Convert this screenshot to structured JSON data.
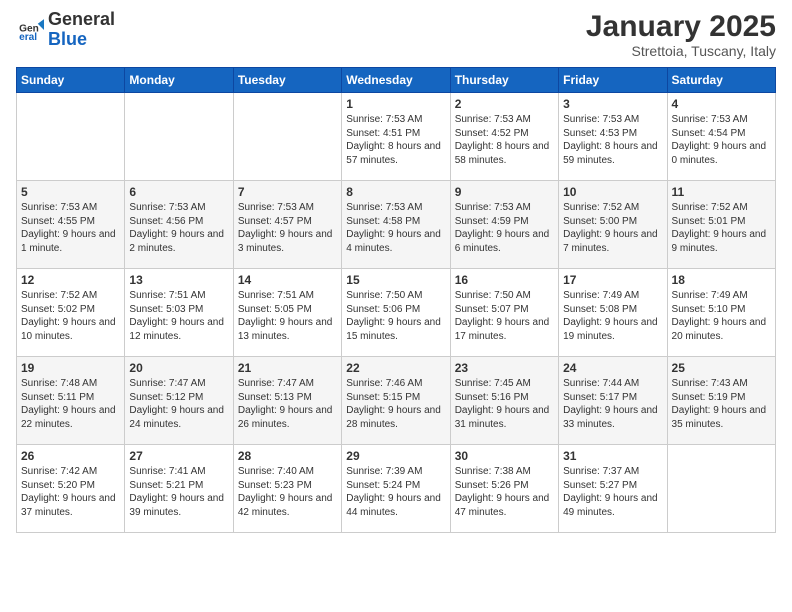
{
  "logo": {
    "general": "General",
    "blue": "Blue"
  },
  "header": {
    "month": "January 2025",
    "location": "Strettoia, Tuscany, Italy"
  },
  "weekdays": [
    "Sunday",
    "Monday",
    "Tuesday",
    "Wednesday",
    "Thursday",
    "Friday",
    "Saturday"
  ],
  "weeks": [
    [
      {
        "day": "",
        "info": ""
      },
      {
        "day": "",
        "info": ""
      },
      {
        "day": "",
        "info": ""
      },
      {
        "day": "1",
        "info": "Sunrise: 7:53 AM\nSunset: 4:51 PM\nDaylight: 8 hours and 57 minutes."
      },
      {
        "day": "2",
        "info": "Sunrise: 7:53 AM\nSunset: 4:52 PM\nDaylight: 8 hours and 58 minutes."
      },
      {
        "day": "3",
        "info": "Sunrise: 7:53 AM\nSunset: 4:53 PM\nDaylight: 8 hours and 59 minutes."
      },
      {
        "day": "4",
        "info": "Sunrise: 7:53 AM\nSunset: 4:54 PM\nDaylight: 9 hours and 0 minutes."
      }
    ],
    [
      {
        "day": "5",
        "info": "Sunrise: 7:53 AM\nSunset: 4:55 PM\nDaylight: 9 hours and 1 minute."
      },
      {
        "day": "6",
        "info": "Sunrise: 7:53 AM\nSunset: 4:56 PM\nDaylight: 9 hours and 2 minutes."
      },
      {
        "day": "7",
        "info": "Sunrise: 7:53 AM\nSunset: 4:57 PM\nDaylight: 9 hours and 3 minutes."
      },
      {
        "day": "8",
        "info": "Sunrise: 7:53 AM\nSunset: 4:58 PM\nDaylight: 9 hours and 4 minutes."
      },
      {
        "day": "9",
        "info": "Sunrise: 7:53 AM\nSunset: 4:59 PM\nDaylight: 9 hours and 6 minutes."
      },
      {
        "day": "10",
        "info": "Sunrise: 7:52 AM\nSunset: 5:00 PM\nDaylight: 9 hours and 7 minutes."
      },
      {
        "day": "11",
        "info": "Sunrise: 7:52 AM\nSunset: 5:01 PM\nDaylight: 9 hours and 9 minutes."
      }
    ],
    [
      {
        "day": "12",
        "info": "Sunrise: 7:52 AM\nSunset: 5:02 PM\nDaylight: 9 hours and 10 minutes."
      },
      {
        "day": "13",
        "info": "Sunrise: 7:51 AM\nSunset: 5:03 PM\nDaylight: 9 hours and 12 minutes."
      },
      {
        "day": "14",
        "info": "Sunrise: 7:51 AM\nSunset: 5:05 PM\nDaylight: 9 hours and 13 minutes."
      },
      {
        "day": "15",
        "info": "Sunrise: 7:50 AM\nSunset: 5:06 PM\nDaylight: 9 hours and 15 minutes."
      },
      {
        "day": "16",
        "info": "Sunrise: 7:50 AM\nSunset: 5:07 PM\nDaylight: 9 hours and 17 minutes."
      },
      {
        "day": "17",
        "info": "Sunrise: 7:49 AM\nSunset: 5:08 PM\nDaylight: 9 hours and 19 minutes."
      },
      {
        "day": "18",
        "info": "Sunrise: 7:49 AM\nSunset: 5:10 PM\nDaylight: 9 hours and 20 minutes."
      }
    ],
    [
      {
        "day": "19",
        "info": "Sunrise: 7:48 AM\nSunset: 5:11 PM\nDaylight: 9 hours and 22 minutes."
      },
      {
        "day": "20",
        "info": "Sunrise: 7:47 AM\nSunset: 5:12 PM\nDaylight: 9 hours and 24 minutes."
      },
      {
        "day": "21",
        "info": "Sunrise: 7:47 AM\nSunset: 5:13 PM\nDaylight: 9 hours and 26 minutes."
      },
      {
        "day": "22",
        "info": "Sunrise: 7:46 AM\nSunset: 5:15 PM\nDaylight: 9 hours and 28 minutes."
      },
      {
        "day": "23",
        "info": "Sunrise: 7:45 AM\nSunset: 5:16 PM\nDaylight: 9 hours and 31 minutes."
      },
      {
        "day": "24",
        "info": "Sunrise: 7:44 AM\nSunset: 5:17 PM\nDaylight: 9 hours and 33 minutes."
      },
      {
        "day": "25",
        "info": "Sunrise: 7:43 AM\nSunset: 5:19 PM\nDaylight: 9 hours and 35 minutes."
      }
    ],
    [
      {
        "day": "26",
        "info": "Sunrise: 7:42 AM\nSunset: 5:20 PM\nDaylight: 9 hours and 37 minutes."
      },
      {
        "day": "27",
        "info": "Sunrise: 7:41 AM\nSunset: 5:21 PM\nDaylight: 9 hours and 39 minutes."
      },
      {
        "day": "28",
        "info": "Sunrise: 7:40 AM\nSunset: 5:23 PM\nDaylight: 9 hours and 42 minutes."
      },
      {
        "day": "29",
        "info": "Sunrise: 7:39 AM\nSunset: 5:24 PM\nDaylight: 9 hours and 44 minutes."
      },
      {
        "day": "30",
        "info": "Sunrise: 7:38 AM\nSunset: 5:26 PM\nDaylight: 9 hours and 47 minutes."
      },
      {
        "day": "31",
        "info": "Sunrise: 7:37 AM\nSunset: 5:27 PM\nDaylight: 9 hours and 49 minutes."
      },
      {
        "day": "",
        "info": ""
      }
    ]
  ]
}
